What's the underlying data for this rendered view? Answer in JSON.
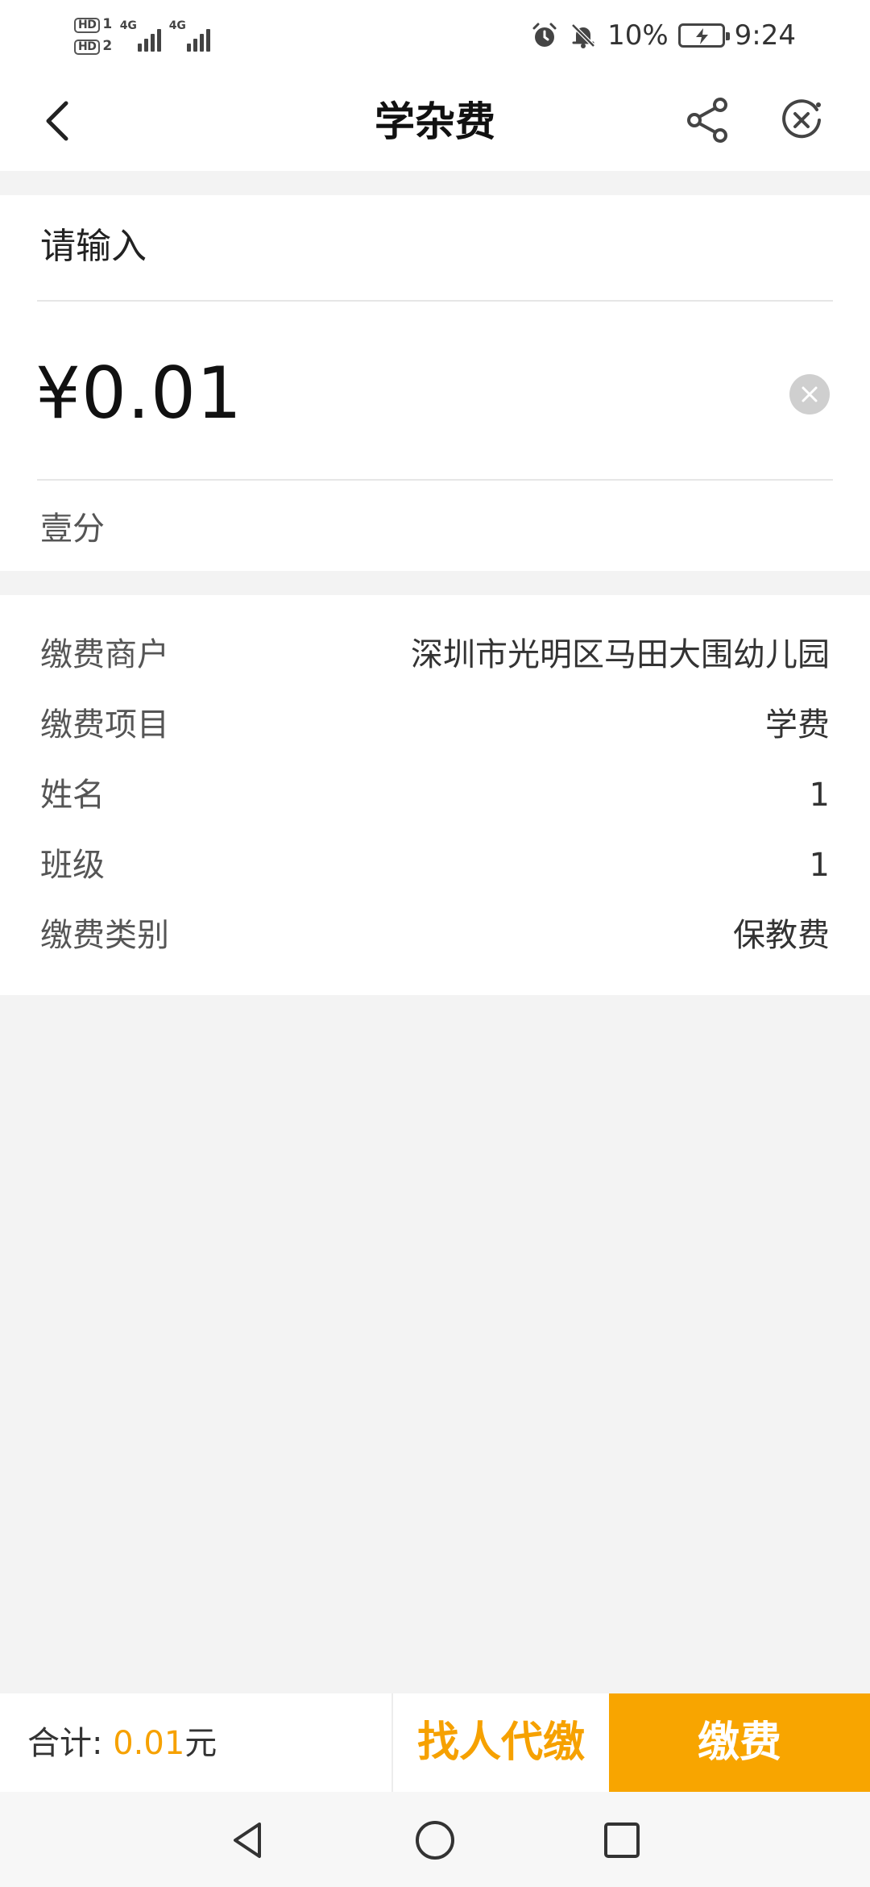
{
  "status_bar": {
    "sim1_label": "HD",
    "sim1_slot": "1",
    "sim2_label": "HD",
    "sim2_slot": "2",
    "network1": "4G",
    "network2": "4G",
    "alarm_icon": "alarm-icon",
    "mute_icon": "bell-off-icon",
    "battery_percent": "10%",
    "time": "9:24"
  },
  "navbar": {
    "title": "学杂费",
    "back_icon": "chevron-left-icon",
    "share_icon": "share-icon",
    "close_icon": "close-circle-icon"
  },
  "amount_card": {
    "input_label": "请输入",
    "amount": "¥0.01",
    "amount_in_words": "壹分",
    "clear_icon": "clear-icon"
  },
  "details": [
    {
      "label": "缴费商户",
      "value": "深圳市光明区马田大围幼儿园"
    },
    {
      "label": "缴费项目",
      "value": "学费"
    },
    {
      "label": "姓名",
      "value": "1"
    },
    {
      "label": "班级",
      "value": "1"
    },
    {
      "label": "缴费类别",
      "value": "保教费"
    }
  ],
  "bottom_bar": {
    "total_label": "合计:",
    "total_amount": "0.01",
    "total_unit": "元",
    "agent_pay_label": "找人代缴",
    "pay_label": "缴费",
    "accent_color": "#f8a500"
  },
  "system_nav": {
    "back_icon": "triangle-back-icon",
    "home_icon": "circle-home-icon",
    "recent_icon": "square-recent-icon"
  }
}
